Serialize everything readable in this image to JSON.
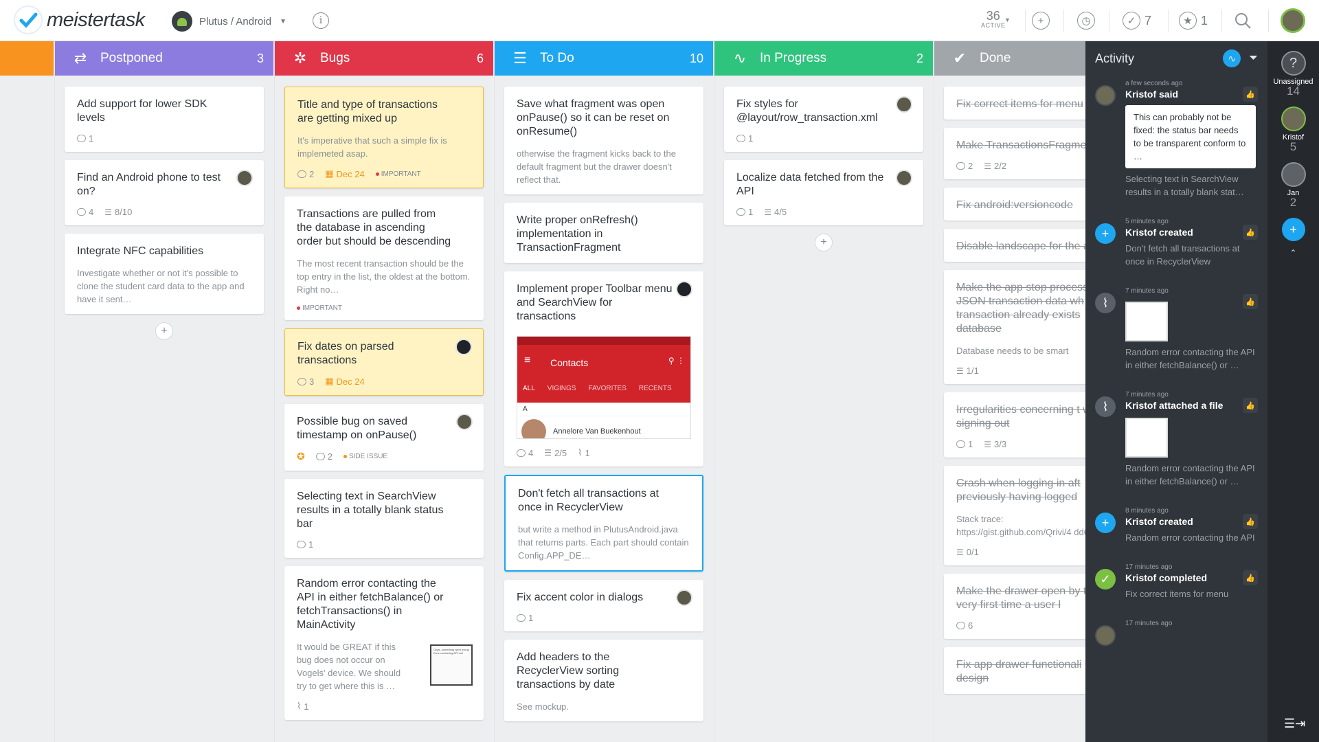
{
  "app": {
    "logo_text": "meistertask",
    "project": "Plutus / Android"
  },
  "toolbar": {
    "active_count": "36",
    "active_label": "ACTIVE",
    "tasks_count": "7",
    "starred_count": "1"
  },
  "colors": {
    "postponed": "#8d7cdf",
    "bugs": "#e1364a",
    "todo": "#1ea7f0",
    "inprogress": "#2fc47e",
    "done": "#a1a6ab",
    "orange": "#f7931e",
    "activity_bg": "#30353b"
  },
  "columns": {
    "postponed": {
      "title": "Postponed",
      "count": "3",
      "cards": [
        {
          "title": "Add support for lower SDK levels",
          "comments": "1"
        },
        {
          "title": "Find an Android phone to test on?",
          "comments": "4",
          "checklist": "8/10"
        },
        {
          "title": "Integrate NFC capabilities",
          "desc": "Investigate whether or not it's possible to clone the student card data to the app and have it sent…"
        }
      ]
    },
    "bugs": {
      "title": "Bugs",
      "count": "6",
      "cards": [
        {
          "title": "Title and type of transactions are getting mixed up",
          "desc": "It's imperative that such a simple fix is implemeted asap.",
          "comments": "2",
          "date": "Dec 24",
          "tag": "IMPORTANT"
        },
        {
          "title": "Transactions are pulled from the database in ascending order but should be descending",
          "desc": "The most recent transaction should be the top entry in the list, the oldest at the bottom. Right no…",
          "tag": "IMPORTANT"
        },
        {
          "title": "Fix dates on parsed transactions",
          "comments": "3",
          "date": "Dec 24"
        },
        {
          "title": "Possible bug on saved timestamp on onPause()",
          "comments": "2",
          "tag": "SIDE ISSUE"
        },
        {
          "title": "Selecting text in SearchView results in a totally blank status bar",
          "comments": "1"
        },
        {
          "title": "Random error contacting the API in either fetchBalance() or fetchTransactions() in MainActivity",
          "desc": "It would be GREAT if this bug does not occur on Vogels' device. We should try to get where this is …",
          "attachments": "1",
          "thumb_line1": "Oops, something went wrong",
          "thumb_line2": "Error contacting API null"
        }
      ]
    },
    "todo": {
      "title": "To Do",
      "count": "10",
      "cards": [
        {
          "title": "Save what fragment was open onPause() so it can be reset on onResume()",
          "desc": "otherwise the fragment kicks back to the default fragment but the drawer doesn't reflect that."
        },
        {
          "title": "Write proper onRefresh() implementation in TransactionFragment"
        },
        {
          "title": "Implement proper Toolbar menu and SearchView for transactions",
          "comments": "4",
          "checklist": "2/5",
          "attachments": "1",
          "screenshot": {
            "title": "Contacts",
            "tabs": [
              "ALL",
              "VIGINGS",
              "FAVORITES",
              "RECENTS"
            ],
            "letter": "A",
            "contact": "Annelore Van Buekenhout"
          }
        },
        {
          "title": "Don't fetch all transactions at once in RecyclerView",
          "desc": "but write a method in PlutusAndroid.java that returns parts. Each part should contain Config.APP_DE…"
        },
        {
          "title": "Fix accent color in dialogs",
          "comments": "1"
        },
        {
          "title": "Add headers to the RecyclerView sorting transactions by date",
          "desc": "See mockup."
        }
      ]
    },
    "inprogress": {
      "title": "In Progress",
      "count": "2",
      "cards": [
        {
          "title": "Fix styles for @layout/row_transaction.xml",
          "comments": "1"
        },
        {
          "title": "Localize data fetched from the API",
          "comments": "1",
          "checklist": "4/5"
        }
      ]
    },
    "done": {
      "title": "Done",
      "cards": [
        {
          "title": "Fix correct items for menu"
        },
        {
          "title": "Make TransactionsFragme",
          "comments": "2",
          "checklist": "2/2"
        },
        {
          "title": "Fix android:versioncode"
        },
        {
          "title": "Disable landscape for the app"
        },
        {
          "title": "Make the app stop process JSON transaction data wh transaction already exists database",
          "desc": "Database needs to be smart",
          "checklist": "1/1"
        },
        {
          "title": "Irregularities concerning t when signing out",
          "comments": "1",
          "checklist": "3/3"
        },
        {
          "title": "Crash when logging in aft previously having logged",
          "desc": "Stack trace:",
          "link": "https://gist.github.com/Qrivi/4 dd6c44b4d98",
          "checklist": "0/1"
        },
        {
          "title": "Make the drawer open by the very first time a user l",
          "comments": "6"
        },
        {
          "title": "Fix app drawer functionali design"
        }
      ]
    }
  },
  "activity": {
    "title": "Activity",
    "items": [
      {
        "time": "a few seconds ago",
        "who": "Kristof said",
        "quote": "This can probably not be fixed: the status bar needs to be transparent conform to …",
        "txt": "Selecting text in SearchView results in a totally blank stat…"
      },
      {
        "time": "5 minutes ago",
        "who": "Kristof created",
        "txt": "Don't fetch all transactions at once in RecyclerView"
      },
      {
        "time": "7 minutes ago",
        "who": "",
        "txt": "Random error contacting the API in either fetchBalance() or …"
      },
      {
        "time": "7 minutes ago",
        "who": "Kristof attached a file",
        "txt": "Random error contacting the API in either fetchBalance() or …"
      },
      {
        "time": "8 minutes ago",
        "who": "Kristof created",
        "txt": "Random error contacting the API"
      },
      {
        "time": "17 minutes ago",
        "who": "Kristof completed",
        "txt": "Fix correct items for menu"
      },
      {
        "time": "17 minutes ago",
        "who": "",
        "txt": ""
      }
    ]
  },
  "members": [
    {
      "name": "Unassigned",
      "count": "14"
    },
    {
      "name": "Kristof",
      "count": "5"
    },
    {
      "name": "Jan",
      "count": "2"
    }
  ]
}
